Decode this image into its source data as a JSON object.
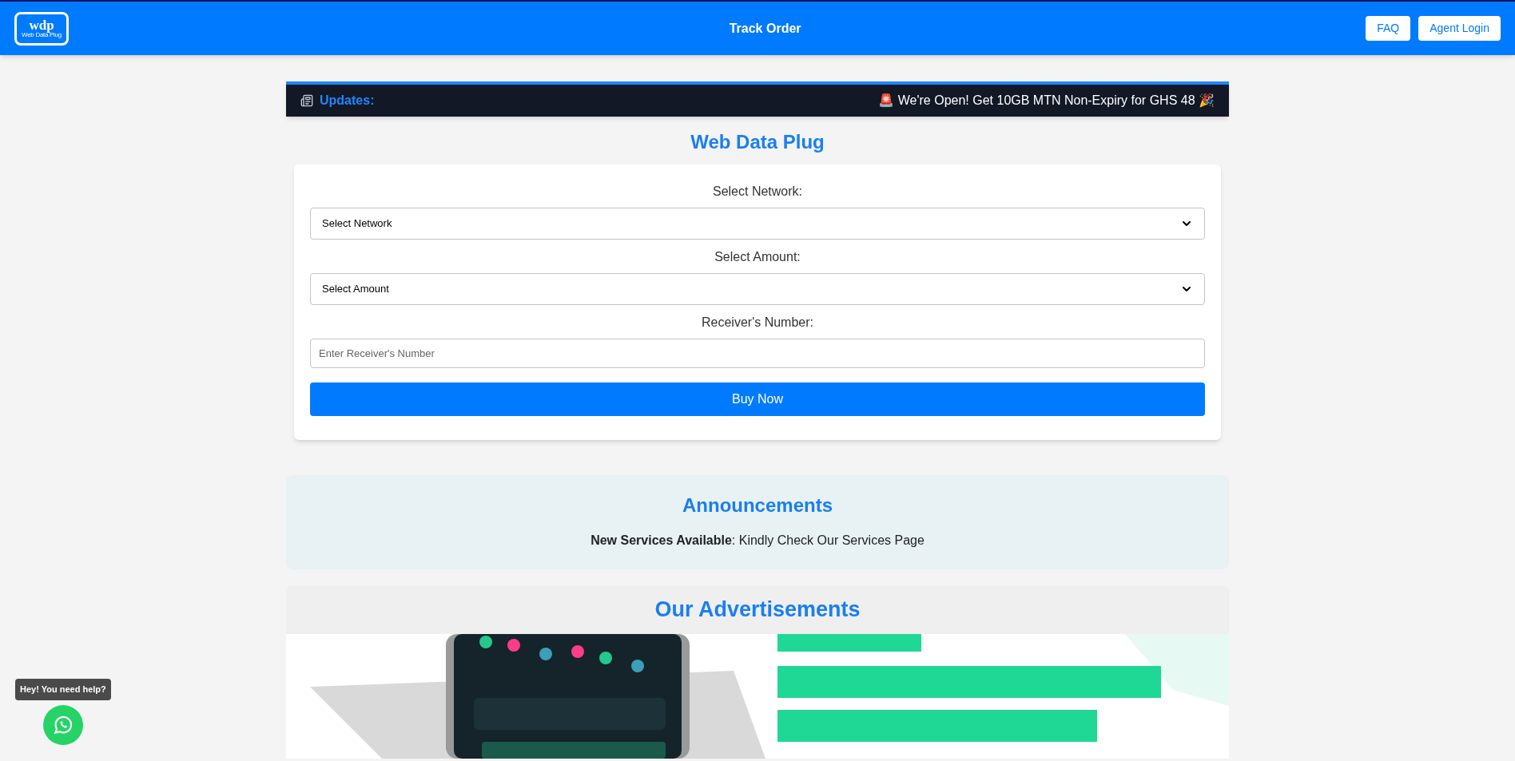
{
  "header": {
    "logo": {
      "mark": "wdp",
      "subtitle": "Web Data Plug"
    },
    "title": "Track Order",
    "buttons": [
      "FAQ",
      "Agent Login"
    ]
  },
  "updates": {
    "label": "Updates:",
    "message": "🚨 We're Open! Get 10GB MTN Non-Expiry for GHS 48 🎉"
  },
  "site_title": "Web Data Plug",
  "form": {
    "fields": [
      {
        "kind": "select",
        "label": "Select Network:",
        "value": "Select Network"
      },
      {
        "kind": "select",
        "label": "Select Amount:",
        "value": "Select Amount"
      },
      {
        "kind": "input",
        "label": "Receiver's Number:",
        "placeholder": "Enter Receiver's Number"
      }
    ],
    "submit": "Buy Now"
  },
  "announcements": {
    "title": "Announcements",
    "text": "**New Services Available**: Kindly Check Our Services Page"
  },
  "advertisements": {
    "title": "Our Advertisements"
  },
  "help": {
    "tooltip": "Hey! You need help?"
  }
}
